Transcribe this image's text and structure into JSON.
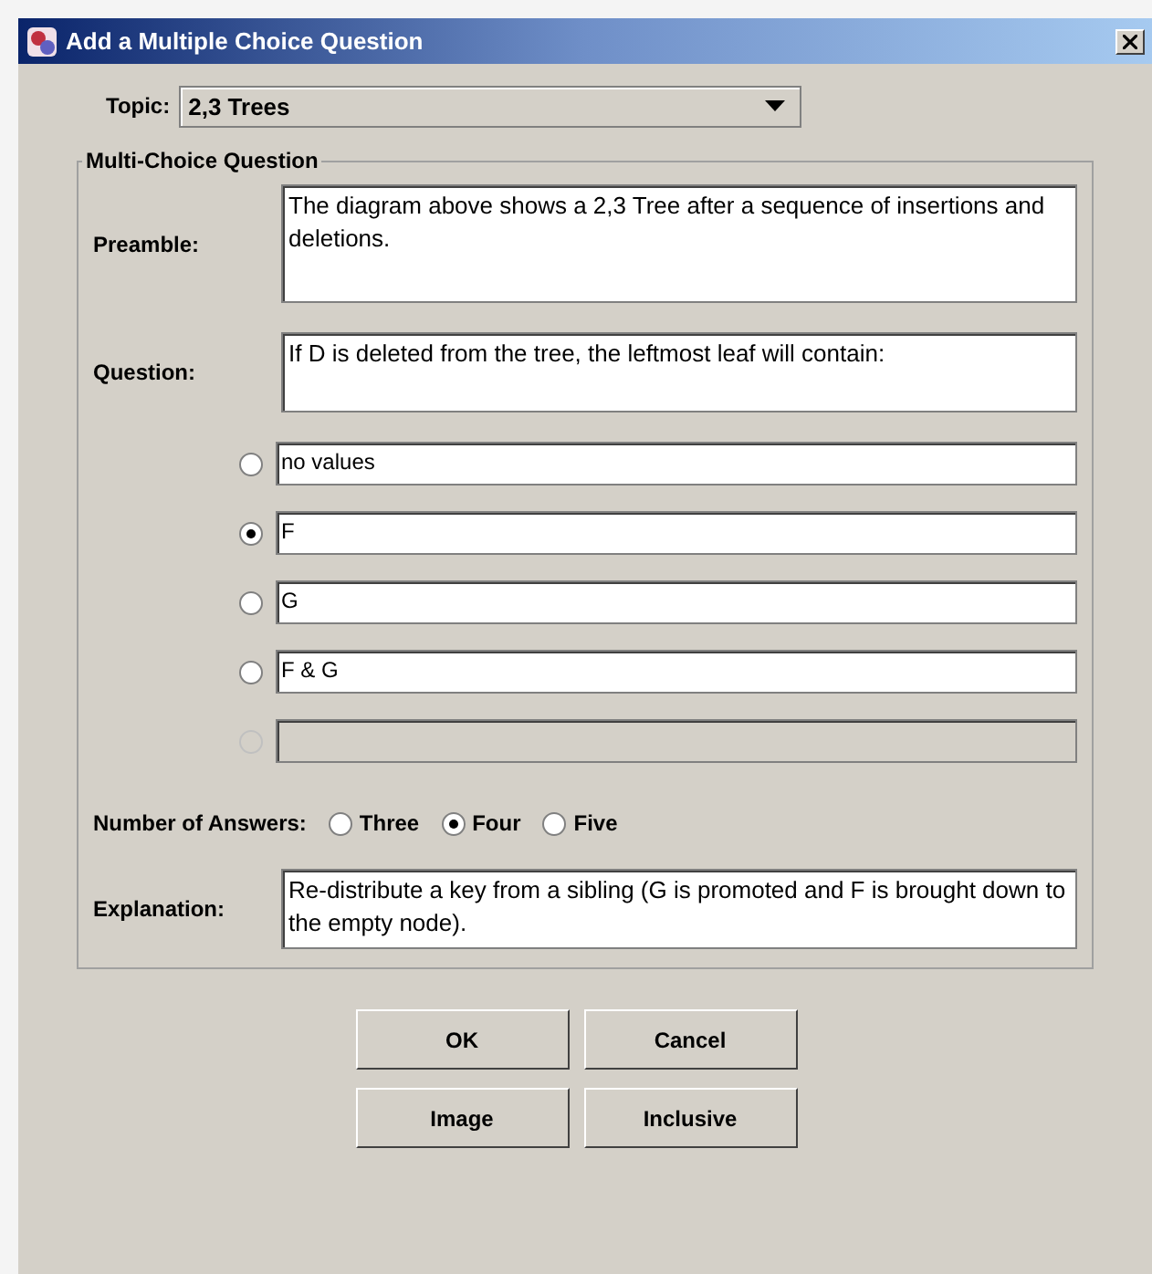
{
  "window": {
    "title": "Add a Multiple Choice Question"
  },
  "topic": {
    "label": "Topic:",
    "value": "2,3 Trees"
  },
  "group": {
    "title": "Multi-Choice Question",
    "preamble": {
      "label": "Preamble:",
      "value": "The diagram above shows a 2,3 Tree after a sequence of insertions and deletions."
    },
    "question": {
      "label": "Question:",
      "value": "If D is deleted from the tree, the leftmost leaf will contain:"
    },
    "answers": [
      {
        "value": "no values",
        "selected": false,
        "disabled": false
      },
      {
        "value": "F",
        "selected": true,
        "disabled": false
      },
      {
        "value": "G",
        "selected": false,
        "disabled": false
      },
      {
        "value": "F & G",
        "selected": false,
        "disabled": false
      },
      {
        "selected": false,
        "disabled": true
      }
    ],
    "number_of_answers": {
      "label": "Number of Answers:",
      "options": [
        {
          "label": "Three",
          "selected": false
        },
        {
          "label": "Four",
          "selected": true
        },
        {
          "label": "Five",
          "selected": false
        }
      ]
    },
    "explanation": {
      "label": "Explanation:",
      "value": "Re-distribute a key from a sibling (G is promoted and F is brought down to the empty node)."
    }
  },
  "buttons": [
    [
      "OK",
      "Cancel"
    ],
    [
      "Image",
      "Inclusive"
    ]
  ]
}
